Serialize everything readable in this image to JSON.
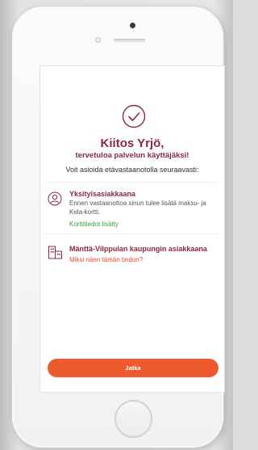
{
  "welcome": {
    "title": "Kiitos Yrjö,",
    "subtitle": "tervetuloa palvelun käyttäjäksi!",
    "intro": "Voit asioida etävastaanotolla seuraavasti:"
  },
  "options": [
    {
      "title": "Yksityisasiakkaana",
      "text": "Ennen vastaanottoa sinun tulee lisätä maksu- ja Kela-kortti.",
      "status": "Korttitiedot lisätty",
      "icon": "user-icon"
    },
    {
      "title": "Mänttä-Vilppulan kaupungin asiakkaana",
      "link": "Miksi näen tämän tiedon?",
      "icon": "building-icon"
    }
  ],
  "actions": {
    "continue_label": "Jatka"
  },
  "colors": {
    "accent": "#8a2844",
    "button": "#ee5a2f",
    "success": "#3f9e3f",
    "link": "#e84c2a"
  }
}
